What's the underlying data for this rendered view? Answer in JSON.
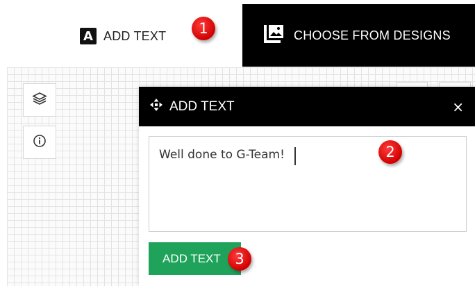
{
  "tabs": {
    "add_text": {
      "label": "ADD TEXT",
      "icon": "a-letter-icon"
    },
    "designs": {
      "label": "CHOOSE FROM DESIGNS",
      "icon": "image-gallery-icon"
    }
  },
  "toolbar": {
    "layers_icon": "layers-icon",
    "info_icon": "info-icon"
  },
  "dialog": {
    "title": "ADD TEXT",
    "title_icon": "move-arrows-icon",
    "close_label": "×",
    "text_value": "Well done to G-Team!",
    "submit_label": "ADD TEXT"
  },
  "steps": [
    "1",
    "2",
    "3"
  ],
  "colors": {
    "primary_dark": "#000000",
    "submit_green": "#1fa35b",
    "step_badge": "#e00000"
  }
}
